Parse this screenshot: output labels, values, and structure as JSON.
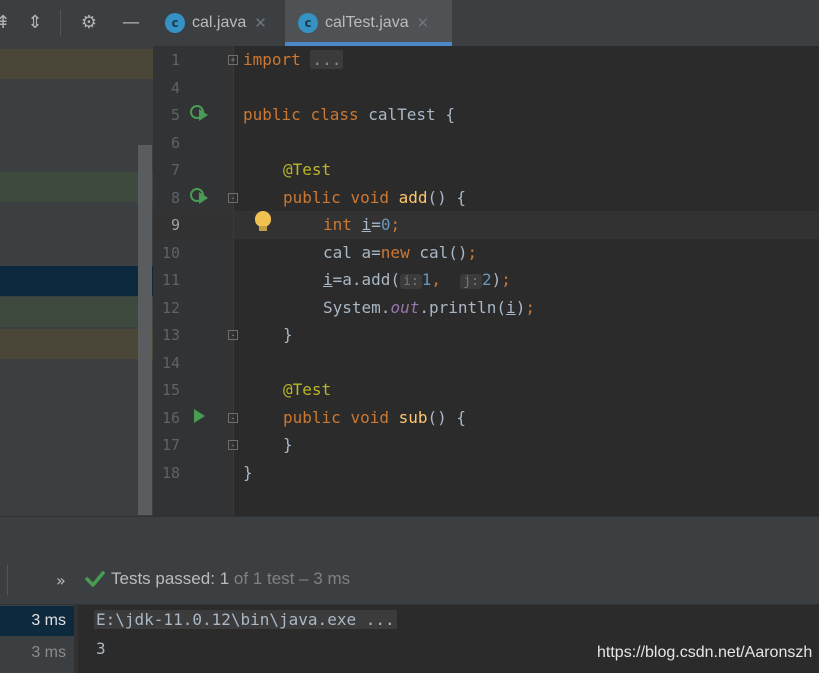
{
  "toolbar": {
    "icons": [
      "collapse-icon",
      "expand-collapse-icon",
      "gear-icon",
      "minimize-icon"
    ]
  },
  "tabs": [
    {
      "label": "cal.java",
      "icon": "class-icon",
      "active": false
    },
    {
      "label": "calTest.java",
      "icon": "class-icon",
      "active": true
    }
  ],
  "editor": {
    "line_numbers": [
      "1",
      "4",
      "5",
      "6",
      "7",
      "8",
      "9",
      "10",
      "11",
      "12",
      "13",
      "14",
      "15",
      "16",
      "17",
      "18"
    ],
    "current_line": "9",
    "lines": {
      "l1": {
        "kw": "import",
        "fold": "..."
      },
      "l5": {
        "kw1": "public",
        "kw2": "class",
        "name": "calTest",
        "brace": "{"
      },
      "l7": {
        "annotation": "@Test"
      },
      "l8": {
        "kw1": "public",
        "kw2": "void",
        "method": "add",
        "rest": "() {"
      },
      "l9": {
        "kw": "int",
        "var": "i",
        "eq": "=",
        "num": "0",
        "semi": ";"
      },
      "l10": {
        "pre": "cal a=",
        "kw": "new",
        "post": " cal()",
        "semi": ";"
      },
      "l11": {
        "var": "i",
        "pre": "=a.add(",
        "hint1": "i:",
        "num1": "1",
        "comma": ",",
        "hint2": "j:",
        "num2": "2",
        "post": ")",
        "semi": ";"
      },
      "l12": {
        "pre": "System.",
        "field": "out",
        "mid": ".println(",
        "var": "i",
        "post": ")",
        "semi": ";"
      },
      "l13": {
        "brace": "}"
      },
      "l15": {
        "annotation": "@Test"
      },
      "l16": {
        "kw1": "public",
        "kw2": "void",
        "method": "sub",
        "rest": "() {"
      },
      "l17": {
        "brace": "}"
      },
      "l18": {
        "brace": "}"
      }
    }
  },
  "test_panel": {
    "chevron": "»",
    "status_label": "Tests passed:",
    "passed": "1",
    "of_total": "of 1 test",
    "duration": "– 3 ms",
    "tree_rows": [
      {
        "time": "3 ms",
        "selected": true
      },
      {
        "time": "3 ms",
        "selected": false
      }
    ]
  },
  "console": {
    "command": "E:\\jdk-11.0.12\\bin\\java.exe ...",
    "output": "3"
  },
  "watermark": "https://blog.csdn.net/Aaronszh",
  "colors": {
    "keyword": "#cc7832",
    "annotation": "#bbb529",
    "method": "#ffc66d",
    "number": "#6897bb",
    "success": "#499c54",
    "tab_accent": "#4a88c7"
  }
}
